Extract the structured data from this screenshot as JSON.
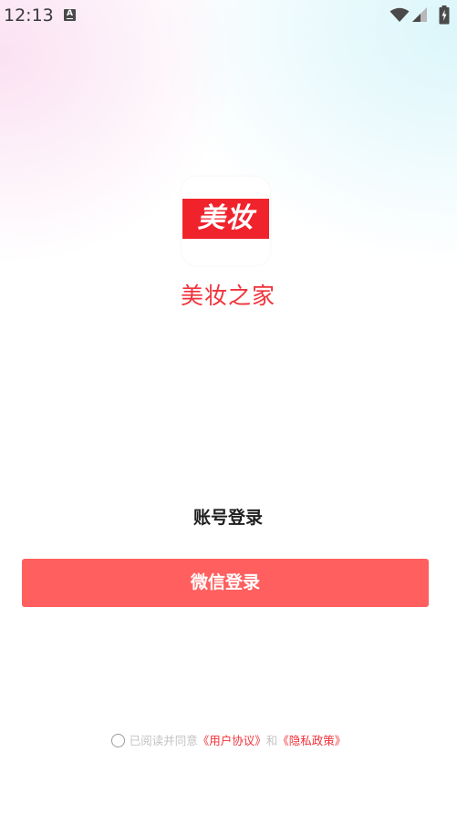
{
  "status_bar": {
    "time": "12:13",
    "notification_glyph": "A",
    "icons": [
      "wifi-icon",
      "signal-icon",
      "battery-icon"
    ]
  },
  "app": {
    "logo_text": "美妆",
    "name": "美妆之家",
    "brand_color": "#f0232d"
  },
  "login": {
    "account_login_label": "账号登录",
    "wechat_login_label": "微信登录",
    "button_color": "#ff5f5f"
  },
  "agreement": {
    "prefix": "已阅读并同意",
    "user_agreement": "《用户协议》",
    "conjunction": "和",
    "privacy_policy": "《隐私政策》",
    "checked": false
  }
}
